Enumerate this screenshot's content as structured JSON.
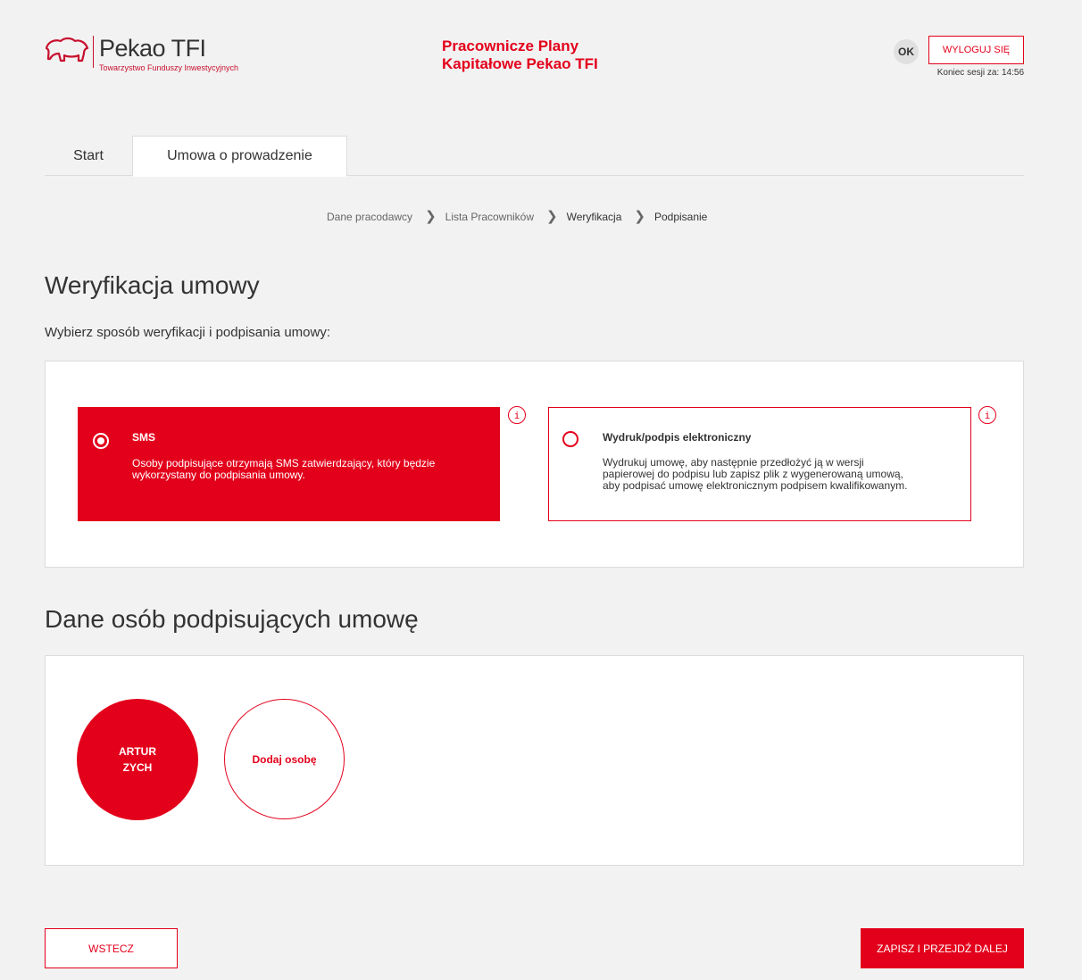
{
  "header": {
    "logo_name": "Pekao TFI",
    "logo_subtitle": "Towarzystwo Funduszy Inwestycyjnych",
    "app_title_line1": "Pracownicze Plany",
    "app_title_line2": "Kapitałowe Pekao TFI",
    "ok_label": "OK",
    "logout_label": "WYLOGUJ SIĘ",
    "session_text": "Koniec sesji za: 14:56"
  },
  "tabs": [
    {
      "label": "Start",
      "active": false
    },
    {
      "label": "Umowa o prowadzenie",
      "active": true
    }
  ],
  "breadcrumb": [
    {
      "label": "Dane pracodawcy",
      "active": false
    },
    {
      "label": "Lista Pracowników",
      "active": false
    },
    {
      "label": "Weryfikacja",
      "active": true
    },
    {
      "label": "Podpisanie",
      "active": true
    }
  ],
  "main": {
    "title": "Weryfikacja umowy",
    "subtitle": "Wybierz sposób weryfikacji i podpisania umowy:"
  },
  "verification_options": [
    {
      "title": "SMS",
      "description": "Osoby podpisujące otrzymają SMS zatwierdzający, który będzie wykorzystany do podpisania umowy.",
      "selected": true
    },
    {
      "title": "Wydruk/podpis elektroniczny",
      "description_line1": "Wydrukuj umowę, aby następnie przedłożyć ją w wersji",
      "description_line2": "papierowej do podpisu lub zapisz plik z wygenerowaną umową,",
      "description_line3": "aby podpisać umowę elektronicznym podpisem kwalifikowanym.",
      "selected": false
    }
  ],
  "info_icon_glyph": "i",
  "signers": {
    "title": "Dane osób podpisujących umowę",
    "persons": [
      {
        "first": "ARTUR",
        "last": "ZYCH"
      }
    ],
    "add_label": "Dodaj osobę"
  },
  "footer": {
    "back_label": "WSTECZ",
    "next_label": "ZAPISZ I PRZEJDŹ DALEJ"
  },
  "colors": {
    "accent": "#e3001b",
    "background": "#f2f2f2"
  }
}
